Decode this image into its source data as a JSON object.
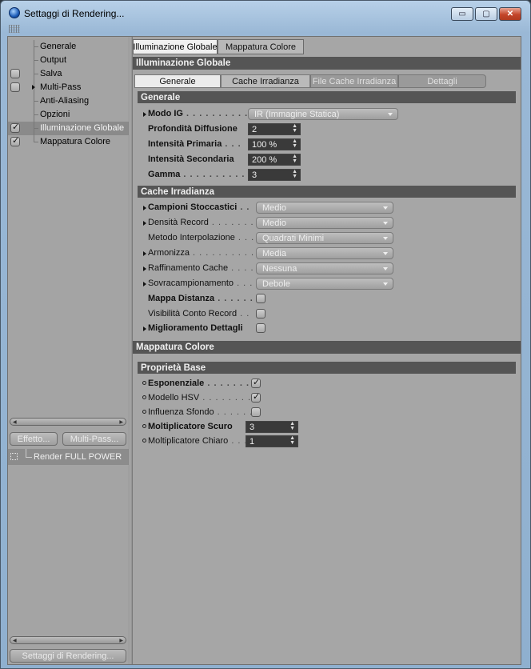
{
  "window": {
    "title": "Settaggi di Rendering...",
    "buttons": {
      "minimize": "▭",
      "maximize": "▢",
      "close": "✕"
    }
  },
  "sidebar": {
    "items": [
      {
        "label": "Generale",
        "checkbox": false
      },
      {
        "label": "Output",
        "checkbox": false
      },
      {
        "label": "Salva",
        "checkbox": true,
        "checked": false
      },
      {
        "label": "Multi-Pass",
        "checkbox": true,
        "checked": false,
        "expander": true
      },
      {
        "label": "Anti-Aliasing",
        "checkbox": false
      },
      {
        "label": "Opzioni",
        "checkbox": false
      },
      {
        "label": "Illuminazione Globale",
        "checkbox": true,
        "checked": true,
        "selected": true
      },
      {
        "label": "Mappatura Colore",
        "checkbox": true,
        "checked": true
      }
    ],
    "effect_button": "Effetto...",
    "multipass_button": "Multi-Pass...",
    "render_setting": "Render FULL POWER",
    "settings_button": "Settaggi di Rendering..."
  },
  "main": {
    "tabs": [
      "Illuminazione Globale",
      "Mappatura Colore"
    ],
    "gi_section": "Illuminazione Globale",
    "subtabs": [
      "Generale",
      "Cache Irradianza",
      "File Cache Irradianza",
      "Dettagli"
    ],
    "generale": {
      "header": "Generale",
      "modo_ig": {
        "label": "Modo IG",
        "value": "IR (Immagine Statica)"
      },
      "profondita": {
        "label": "Profondità Diffusione",
        "value": "2"
      },
      "intensita_primaria": {
        "label": "Intensità Primaria",
        "value": "100 %"
      },
      "intensita_secondaria": {
        "label": "Intensità Secondaria",
        "value": "200 %"
      },
      "gamma": {
        "label": "Gamma",
        "value": "3"
      }
    },
    "cache": {
      "header": "Cache Irradianza",
      "campioni": {
        "label": "Campioni Stoccastici",
        "value": "Medio"
      },
      "densita": {
        "label": "Densità Record",
        "value": "Medio"
      },
      "metodo": {
        "label": "Metodo Interpolazione",
        "value": "Quadrati Minimi"
      },
      "armonizza": {
        "label": "Armonizza",
        "value": "Media"
      },
      "raffinamento": {
        "label": "Raffinamento Cache",
        "value": "Nessuna"
      },
      "sovracamp": {
        "label": "Sovracampionamento",
        "value": "Debole"
      },
      "mappa_distanza": {
        "label": "Mappa Distanza",
        "checked": false
      },
      "visibilita": {
        "label": "Visibilità Conto Record",
        "checked": false
      },
      "miglioramento": {
        "label": "Miglioramento Dettagli",
        "checked": false
      }
    },
    "mapping_section": "Mappatura Colore",
    "proprieta": {
      "header": "Proprietà Base",
      "esponenziale": {
        "label": "Esponenziale",
        "checked": true
      },
      "hsv": {
        "label": "Modello HSV",
        "checked": true
      },
      "sfondo": {
        "label": "Influenza Sfondo",
        "checked": false
      },
      "scuro": {
        "label": "Moltiplicatore Scuro",
        "value": "3"
      },
      "chiaro": {
        "label": "Moltiplicatore Chiaro",
        "value": "1"
      }
    }
  },
  "colors": {
    "panel": "#a6a6a6",
    "section_header": "#555555",
    "selected": "#8a8a8a",
    "field_dark": "#3a3a3a"
  }
}
